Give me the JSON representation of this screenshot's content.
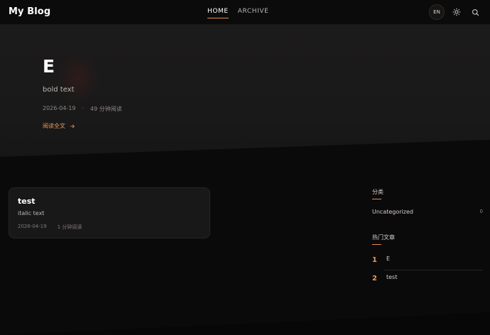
{
  "header": {
    "brand": "My Blog",
    "nav": [
      {
        "label": "HOME",
        "active": true
      },
      {
        "label": "ARCHIVE",
        "active": false
      }
    ],
    "lang_label": "EN",
    "icons": [
      "sun-icon",
      "search-icon"
    ]
  },
  "hero": {
    "title": "E",
    "excerpt": "bold text",
    "date": "2026-04-19",
    "separator": "·",
    "read_time": "49 分钟阅读",
    "read_more": "阅读全文"
  },
  "posts": [
    {
      "title": "test",
      "excerpt": "italic text",
      "date": "2026-04-19",
      "read_time": "1 分钟阅读"
    }
  ],
  "sidebar": {
    "categories_heading": "分类",
    "categories": [
      {
        "name": "Uncategorized",
        "count": "0"
      }
    ],
    "popular_heading": "热门文章",
    "popular": [
      {
        "rank": "1",
        "title": "E"
      },
      {
        "rank": "2",
        "title": "test"
      }
    ]
  },
  "colors": {
    "accent": "#ef9a5a",
    "background": "#0b0a0a",
    "card": "#191818"
  }
}
